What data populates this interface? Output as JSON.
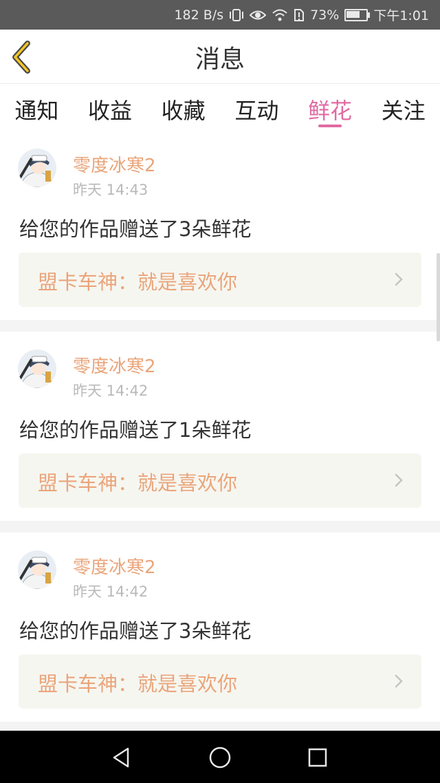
{
  "status_bar": {
    "net_speed": "182 B/s",
    "battery": "73%",
    "battery_level": 0.73,
    "time": "下午1:01",
    "icons": [
      "vibrate-icon",
      "eye-icon",
      "wifi-icon",
      "sim-alert-icon",
      "battery-icon"
    ]
  },
  "header": {
    "title": "消息",
    "back_icon": "chevron-left-icon"
  },
  "tabs": [
    {
      "label": "通知"
    },
    {
      "label": "收益"
    },
    {
      "label": "收藏"
    },
    {
      "label": "互动"
    },
    {
      "label": "鲜花",
      "active": true
    },
    {
      "label": "关注"
    }
  ],
  "messages": [
    {
      "user": "零度冰寒2",
      "time": "昨天 14:43",
      "text": "给您的作品赠送了3朵鲜花",
      "work": "盟卡车神：就是喜欢你"
    },
    {
      "user": "零度冰寒2",
      "time": "昨天 14:42",
      "text": "给您的作品赠送了1朵鲜花",
      "work": "盟卡车神：就是喜欢你"
    },
    {
      "user": "零度冰寒2",
      "time": "昨天 14:42",
      "text": "给您的作品赠送了3朵鲜花",
      "work": "盟卡车神：就是喜欢你"
    }
  ],
  "colors": {
    "accent": "#e06aa2",
    "name": "#eaa57b",
    "card_bg": "#f6f6f0"
  }
}
